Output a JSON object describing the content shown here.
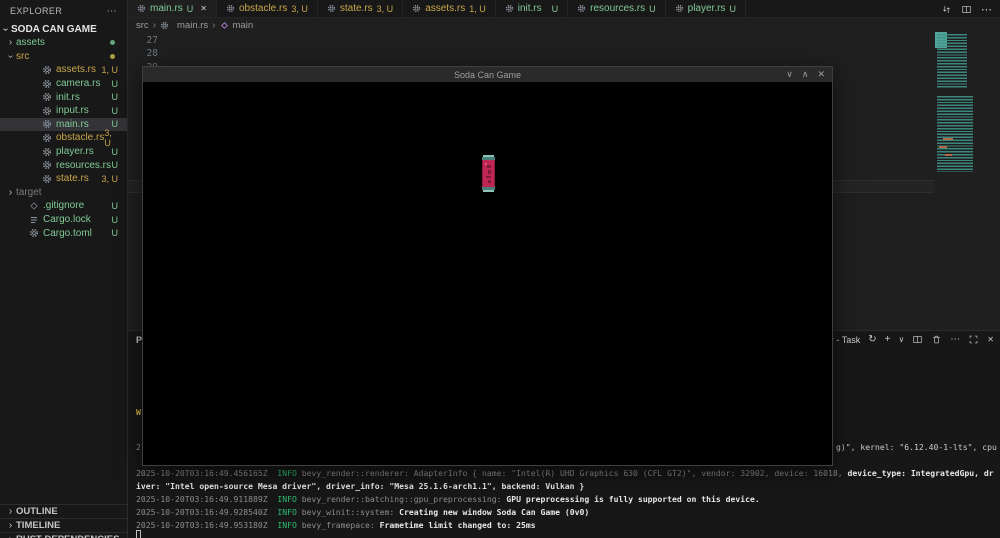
{
  "colors": {
    "bg": "#1f1f1f",
    "sidebar": "#181818",
    "border": "#2b2b2b",
    "warn": "#c8a64a",
    "green": "#81c995",
    "dim": "#8d8d8d",
    "bright": "#e8e8e8",
    "info": "#2dbd6e",
    "ignored": "#7a7a7a",
    "purple": "#b180d7",
    "titlebar": "#2a2a2a",
    "titletext": "#9d9d9d",
    "selRow": "#343438",
    "dotGreen": "#63a57e",
    "dotYellow": "#a8a13f",
    "minimapOrange": "#b0694a"
  },
  "explorer": {
    "title": "EXPLORER",
    "menu": "⋯",
    "root": "SODA CAN GAME",
    "tree": [
      {
        "label": "assets"
      },
      {
        "label": "src"
      },
      {
        "label": "assets.rs",
        "badge": "1, U"
      },
      {
        "label": "camera.rs",
        "badge": "U"
      },
      {
        "label": "init.rs",
        "badge": "U"
      },
      {
        "label": "input.rs",
        "badge": "U"
      },
      {
        "label": "main.rs",
        "badge": "U"
      },
      {
        "label": "obstacle.rs",
        "badge": "3, U"
      },
      {
        "label": "player.rs",
        "badge": "U"
      },
      {
        "label": "resources.rs",
        "badge": "U"
      },
      {
        "label": "state.rs",
        "badge": "3, U"
      },
      {
        "label": "target"
      },
      {
        "label": ".gitignore",
        "badge": "U"
      },
      {
        "label": "Cargo.lock",
        "badge": "U"
      },
      {
        "label": "Cargo.toml",
        "badge": "U"
      }
    ],
    "sections": [
      {
        "label": "OUTLINE"
      },
      {
        "label": "TIMELINE"
      },
      {
        "label": "RUST DEPENDENCIES"
      }
    ]
  },
  "tabs": [
    {
      "label": "main.rs",
      "badge": "U"
    },
    {
      "label": "obstacle.rs",
      "badge": "3, U"
    },
    {
      "label": "state.rs",
      "badge": "3, U"
    },
    {
      "label": "assets.rs",
      "badge": "1, U"
    },
    {
      "label": "init.rs",
      "badge": "U"
    },
    {
      "label": "resources.rs",
      "badge": "U"
    },
    {
      "label": "player.rs",
      "badge": "U"
    }
  ],
  "breadcrumb": {
    "items": [
      "src",
      "main.rs",
      "main"
    ],
    "sep": "›"
  },
  "editor": {
    "line_numbers": [
      "27",
      "28",
      "29"
    ]
  },
  "game_window": {
    "title": "Soda Can Game",
    "minimize": "∨",
    "maximize": "∧",
    "close": "✕"
  },
  "panel": {
    "tab_fragment": "P",
    "terminal_label": "descroller - Task",
    "spinner": "↻",
    "plus": "+",
    "dropdown": "∨",
    "more": "⋯",
    "close": "✕"
  },
  "terminal": {
    "warning_fragment": "W",
    "line_start_fragment": "2",
    "tail": {
      "dim": "g)\", ",
      "bright": "kernel: \"6.12.40-1-lts\", cpu"
    },
    "l1": {
      "ts": "2025-10-20T03:16:49.456165Z  ",
      "level": "INFO",
      "module": " bevy_render::renderer: ",
      "dim": "AdapterInfo { name: \"Intel(R) UHD Graphics 630 (CFL GT2)\", vendor: 32902, device: 16018,",
      "bright": " device_type: IntegratedGpu, dr"
    },
    "l2": {
      "bright": "iver: \"Intel open-source Mesa driver\", driver_info: \"Mesa 25.1.6-arch1.1\", backend: Vulkan }"
    },
    "l3": {
      "ts": "2025-10-20T03:16:49.911889Z  ",
      "level": "INFO",
      "module": " bevy_render::batching::gpu_preprocessing:",
      "bright": " GPU preprocessing is fully supported on this device."
    },
    "l4": {
      "ts": "2025-10-20T03:16:49.928540Z  ",
      "level": "INFO",
      "module": " bevy_winit::system:",
      "bright": " Creating new window Soda Can Game (0v0)"
    },
    "l5": {
      "ts": "2025-10-20T03:16:49.953180Z  ",
      "level": "INFO",
      "module": " bevy_framepace:",
      "bright": " Frametime limit changed to: 25ms"
    }
  },
  "icons": {
    "chevron": "›"
  }
}
